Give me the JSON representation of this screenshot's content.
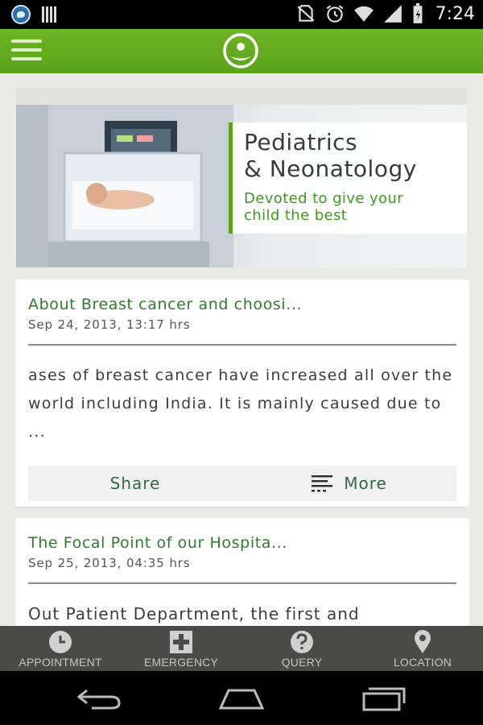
{
  "status_bar": {
    "time": "7:24"
  },
  "banner": {
    "title": "Pediatrics\n& Neonatology",
    "subtitle": "Devoted to give your\nchild the best",
    "dots": [
      false,
      false,
      false,
      true,
      false
    ]
  },
  "articles": [
    {
      "title": "About Breast cancer and choosi...",
      "date": "Sep 24, 2013, 13:17 hrs",
      "excerpt": "ases of breast cancer have increased all over the world including India. It is mainly caused due to ...",
      "share_label": "Share",
      "more_label": "More"
    },
    {
      "title": "The Focal Point of our Hospita...",
      "date": "Sep 25, 2013, 04:35 hrs",
      "excerpt": "Out Patient Department, the first and"
    }
  ],
  "tabs": [
    {
      "label": "APPOINTMENT",
      "icon": "clock-icon"
    },
    {
      "label": "EMERGENCY",
      "icon": "medical-cross-icon"
    },
    {
      "label": "QUERY",
      "icon": "question-icon"
    },
    {
      "label": "LOCATION",
      "icon": "location-pin-icon"
    }
  ],
  "colors": {
    "brand_green": "#5aa21a",
    "title_green": "#2e7a2e",
    "tab_bar": "#4a4a49",
    "active_dot": "#7cc2ea"
  }
}
